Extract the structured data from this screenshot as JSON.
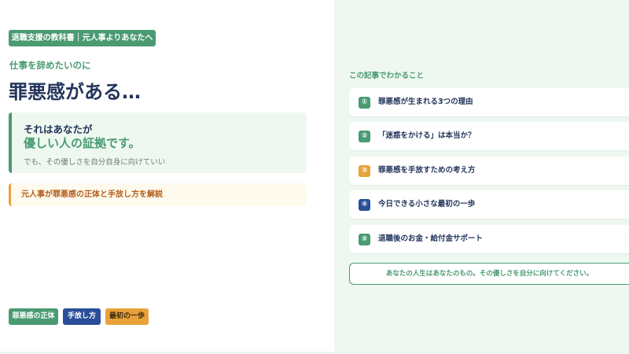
{
  "header_badge": "退職支援の教科書｜元人事よりあなたへ",
  "lead": "仕事を辞めたいのに",
  "title": "罪悪感がある…",
  "message_box": {
    "line1": "それはあなたが",
    "line2": "優しい人の証拠です。",
    "line3": "でも、その優しさを自分自身に向けていい"
  },
  "notice": "元人事が罪悪感の正体と手放し方を解説",
  "tags": [
    {
      "label": "罪悪感の正体",
      "color": "#4a9a72"
    },
    {
      "label": "手放し方",
      "color": "#2a4f98"
    },
    {
      "label": "最初の一歩",
      "color": "#e8a23a"
    }
  ],
  "toc": {
    "heading": "この記事でわかること",
    "items": [
      {
        "num": "①",
        "label": "罪悪感が生まれる3つの理由",
        "color": "#4a9a72"
      },
      {
        "num": "②",
        "label": "「迷惑をかける」は本当か？",
        "color": "#4a9a72"
      },
      {
        "num": "③",
        "label": "罪悪感を手放すための考え方",
        "color": "#e8a23a"
      },
      {
        "num": "④",
        "label": "今日できる小さな最初の一歩",
        "color": "#2a4f98"
      },
      {
        "num": "⑤",
        "label": "退職後のお金・給付金サポート",
        "color": "#4a9a72"
      }
    ]
  },
  "closing": "あなたの人生はあなたのもの。その優しさを自分に向けてください。"
}
